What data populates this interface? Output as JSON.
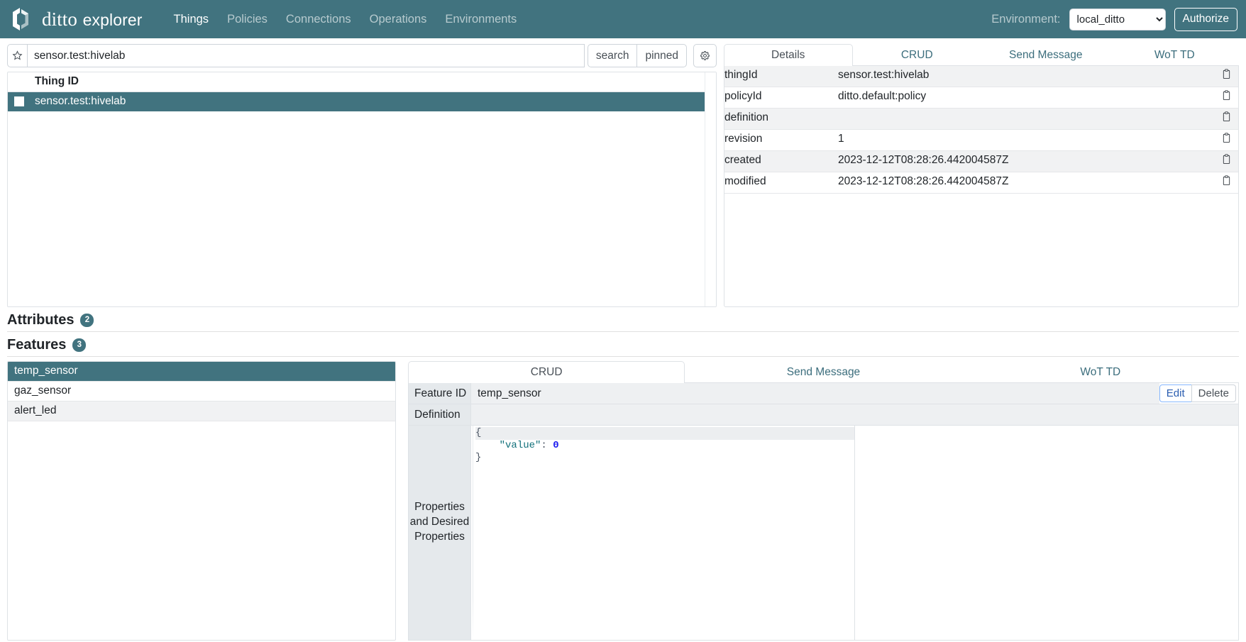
{
  "navbar": {
    "brand_primary": "ditto",
    "brand_secondary": "explorer",
    "logo_icon": "ditto-logo-icon",
    "links": [
      {
        "label": "Things",
        "active": true
      },
      {
        "label": "Policies",
        "active": false
      },
      {
        "label": "Connections",
        "active": false
      },
      {
        "label": "Operations",
        "active": false
      },
      {
        "label": "Environments",
        "active": false
      }
    ],
    "environment_label": "Environment:",
    "environment_value": "local_ditto",
    "environment_options": [
      "local_ditto"
    ],
    "authorize_label": "Authorize",
    "background_color": "#41737f"
  },
  "search": {
    "star_icon": "star-icon",
    "value": "sensor.test:hivelab",
    "placeholder": "",
    "search_button": "search",
    "pinned_button": "pinned",
    "gear_icon": "gear-icon"
  },
  "thing_list": {
    "column_header": "Thing ID",
    "rows": [
      {
        "id": "sensor.test:hivelab",
        "selected": true
      }
    ]
  },
  "thing_panel": {
    "tabs": [
      {
        "label": "Details",
        "active": true
      },
      {
        "label": "CRUD",
        "active": false
      },
      {
        "label": "Send Message",
        "active": false
      },
      {
        "label": "WoT TD",
        "active": false
      }
    ],
    "details": [
      {
        "key": "thingId",
        "value": "sensor.test:hivelab",
        "copy_icon": "clipboard-icon"
      },
      {
        "key": "policyId",
        "value": "ditto.default:policy",
        "copy_icon": "clipboard-icon"
      },
      {
        "key": "definition",
        "value": "",
        "copy_icon": "clipboard-icon"
      },
      {
        "key": "revision",
        "value": "1",
        "copy_icon": "clipboard-icon"
      },
      {
        "key": "created",
        "value": "2023-12-12T08:28:26.442004587Z",
        "copy_icon": "clipboard-icon"
      },
      {
        "key": "modified",
        "value": "2023-12-12T08:28:26.442004587Z",
        "copy_icon": "clipboard-icon"
      }
    ]
  },
  "sections": {
    "attributes": {
      "title": "Attributes",
      "count": "2"
    },
    "features": {
      "title": "Features",
      "count": "3"
    }
  },
  "feature_list": [
    {
      "name": "temp_sensor",
      "selected": true
    },
    {
      "name": "gaz_sensor",
      "selected": false
    },
    {
      "name": "alert_led",
      "selected": false
    }
  ],
  "feature_panel": {
    "tabs": [
      {
        "label": "CRUD",
        "active": true
      },
      {
        "label": "Send Message",
        "active": false
      },
      {
        "label": "WoT TD",
        "active": false
      }
    ],
    "feature_id_label": "Feature ID",
    "feature_id_value": "temp_sensor",
    "edit_label": "Edit",
    "delete_label": "Delete",
    "definition_label": "Definition",
    "definition_value": "",
    "properties_label": "Properties and Desired Properties",
    "properties_json": {
      "line_open": "{",
      "key": "\"value\"",
      "colon": ":",
      "number": "0",
      "line_close": "}"
    },
    "desired_properties_json": ""
  }
}
